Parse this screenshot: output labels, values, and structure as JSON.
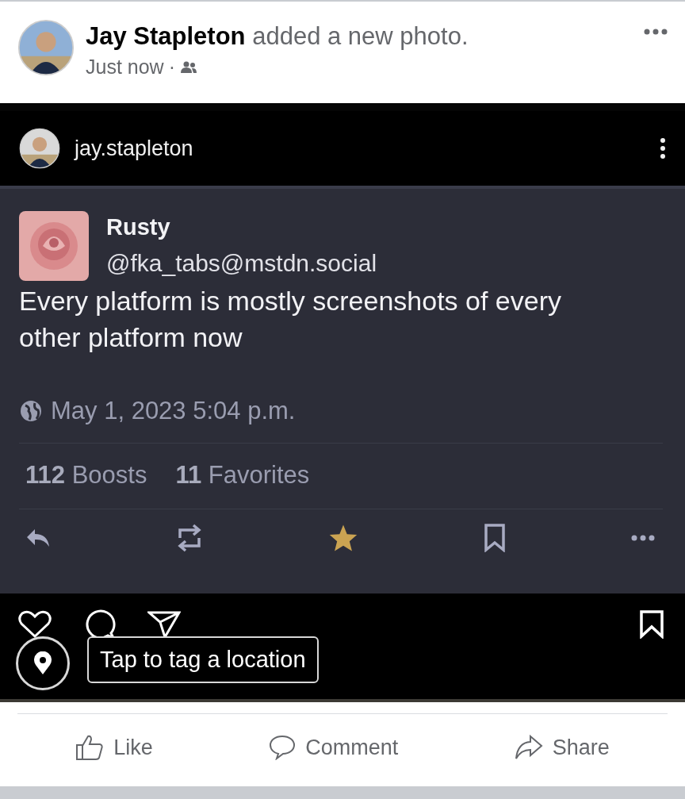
{
  "post": {
    "author": "Jay Stapleton",
    "action": "added a new photo.",
    "time": "Just now",
    "separator": "·"
  },
  "photo": {
    "ig_user": "jay.stapleton",
    "toot": {
      "name": "Rusty",
      "handle": "@fka_tabs@mstdn.social",
      "text": "Every platform is mostly screenshots of every other platform now",
      "date": "May 1, 2023 5:04 p.m.",
      "boosts_count": "112",
      "boosts_label": "Boosts",
      "favorites_count": "11",
      "favorites_label": "Favorites",
      "actions": [
        {
          "kind": "reply"
        },
        {
          "kind": "boost"
        },
        {
          "kind": "favorite",
          "favorited": true
        },
        {
          "kind": "bookmark"
        },
        {
          "kind": "more"
        }
      ]
    },
    "tooltip": "Tap to tag a location"
  },
  "footer_actions": [
    {
      "kind": "like",
      "label": "Like"
    },
    {
      "kind": "comment",
      "label": "Comment"
    },
    {
      "kind": "share",
      "label": "Share"
    }
  ]
}
